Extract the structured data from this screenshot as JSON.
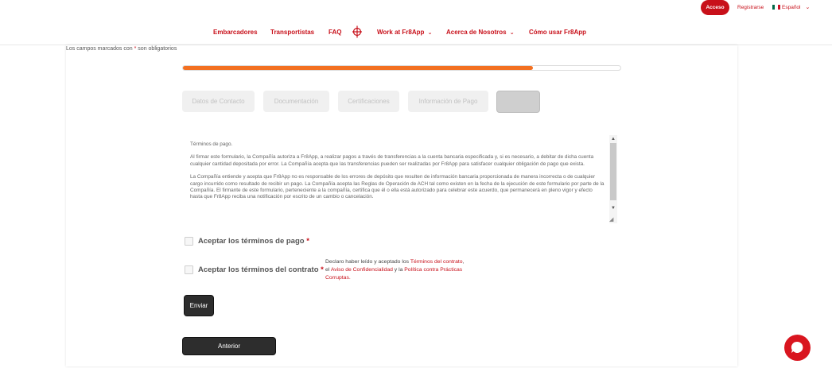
{
  "header": {
    "acceso_label": "Acceso",
    "registrarse_label": "Registrarse",
    "language_label": "Español",
    "flag_colors": [
      "#006847",
      "#ffffff",
      "#ce1126"
    ]
  },
  "nav": {
    "items": [
      {
        "label": "Embarcadores"
      },
      {
        "label": "Transportistas"
      },
      {
        "label": "FAQ"
      },
      {
        "label": "Work at Fr8App"
      },
      {
        "label": "Acerca de Nosotros"
      },
      {
        "label": "Cómo usar Fr8App"
      }
    ],
    "chevron_icon": "chevron-down-icon",
    "logo_icon": "fr8app-logo-icon"
  },
  "form": {
    "required_note_prefix": "Los campos marcados con",
    "required_star": "*",
    "required_note_suffix": "son obligatorios",
    "progress_percent": 80,
    "accent_color": "#f37021",
    "brand_color": "#c8101a",
    "steps": [
      {
        "label": "Datos de Contacto"
      },
      {
        "label": "Documentación"
      },
      {
        "label": "Certificaciones"
      },
      {
        "label": "Información de Pago"
      },
      {
        "label": ""
      }
    ],
    "terms": {
      "paragraphs": [
        "Términos de pago.",
        "Al firmar este formulario, la Compañía autoriza a Fr8App, a realizar pagos a través de transferencias a la cuenta bancaria especificada y, si es necesario, a debitar de dicha cuenta cualquier cantidad depositada por error. La Compañía acepta que las transferencias pueden ser realizadas por  Fr8App para satisfacer cualquier obligación de pago que exista.",
        "La Compañía entiende y acepta que Fr8App no es responsable de los errores de depósito que resulten de información bancaria proporcionada de  manera incorrecta o de cualquier cargo incurrido como resultado de recibir un pago. La Compañía acepta las Reglas de Operación de ACH tal  como existen en la fecha de la ejecución de este formulario por parte de la Compañía. El firmante de este formulario, perteneciente a la compañía,  certifica que él o ella está autorizado para celebrar este acuerdo, que permanecerá en pleno vigor y efecto hasta que Fr8App reciba una notificación  por escrito de un cambio o cancelación."
      ]
    },
    "accept_payment_label": "Aceptar los términos de pago",
    "accept_contract_label": "Aceptar los términos del contrato",
    "contract_note": {
      "prefix": "Declaro haber leído y aceptado los",
      "link1": "Términos del contrato",
      "sep": ", el",
      "link2": "Aviso de Confidencialidad",
      "and": "y la",
      "link3": "Política contra Prácticas Corruptas",
      "end": "."
    },
    "submit_label": "Enviar",
    "previous_label": "Anterior"
  }
}
